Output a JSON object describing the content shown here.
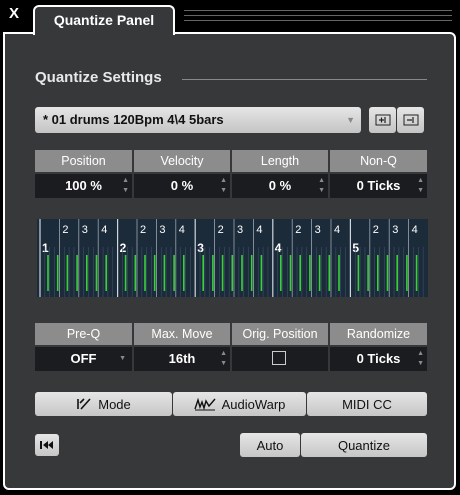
{
  "window": {
    "close_label": "X",
    "tab_title": "Quantize Panel"
  },
  "section": {
    "title": "Quantize Settings"
  },
  "preset": {
    "value": "* 01 drums 120Bpm 4\\4 5bars"
  },
  "params_row1": [
    {
      "label": "Position",
      "value": "100 %"
    },
    {
      "label": "Velocity",
      "value": "0 %"
    },
    {
      "label": "Length",
      "value": "0 %"
    },
    {
      "label": "Non-Q",
      "value": "0 Ticks"
    }
  ],
  "grid": {
    "bars": [
      "1",
      "2",
      "3",
      "4",
      "5"
    ],
    "beats": [
      "2",
      "3",
      "4"
    ]
  },
  "params_row2": [
    {
      "label": "Pre-Q",
      "value": "OFF"
    },
    {
      "label": "Max. Move",
      "value": "16th"
    },
    {
      "label": "Orig. Position",
      "value": ""
    },
    {
      "label": "Randomize",
      "value": "0 Ticks"
    }
  ],
  "modes": {
    "mode": "Mode",
    "audiowarp": "AudioWarp",
    "midi_cc": "MIDI CC"
  },
  "actions": {
    "auto": "Auto",
    "quantize": "Quantize"
  },
  "colors": {
    "accent_green": "#3ad03a",
    "panel": "#36383a",
    "header": "#8c8c8c"
  }
}
